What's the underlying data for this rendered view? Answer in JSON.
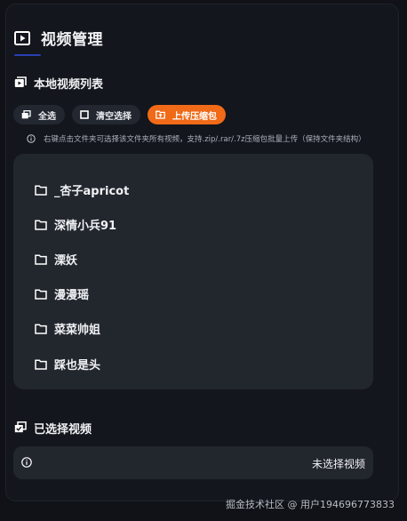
{
  "header": {
    "title": "视频管理",
    "icon": "video-play-icon"
  },
  "local_list": {
    "heading": "本地视频列表",
    "heading_icon": "video-collection-icon",
    "buttons": [
      {
        "label": "全选",
        "icon": "select-all-icon"
      },
      {
        "label": "清空选择",
        "icon": "clear-selection-icon"
      },
      {
        "label": "上传压缩包",
        "icon": "upload-folder-icon",
        "accent": "#f06a18"
      }
    ],
    "hint": "右键点击文件夹可选择该文件夹所有视频，支持.zip/.rar/.7z压缩包批量上传（保持文件夹结构）",
    "folders": [
      {
        "name": "_杏子apricot",
        "icon": "folder-icon"
      },
      {
        "name": "深情小兵91",
        "icon": "folder-icon"
      },
      {
        "name": "溧妖",
        "icon": "folder-icon"
      },
      {
        "name": "漫漫瑶",
        "icon": "folder-icon"
      },
      {
        "name": "菜菜帅姐",
        "icon": "folder-icon"
      },
      {
        "name": "踩也是头",
        "icon": "folder-icon"
      }
    ]
  },
  "selected": {
    "heading": "已选择视频",
    "heading_icon": "selected-videos-icon",
    "empty_text": "未选择视频",
    "info_icon": "info-icon"
  },
  "watermark": "掘金技术社区 @ 用户194696773833",
  "colors": {
    "accent": "#f06a18",
    "title_underline": "#2a3fb4",
    "background": "#101217"
  }
}
